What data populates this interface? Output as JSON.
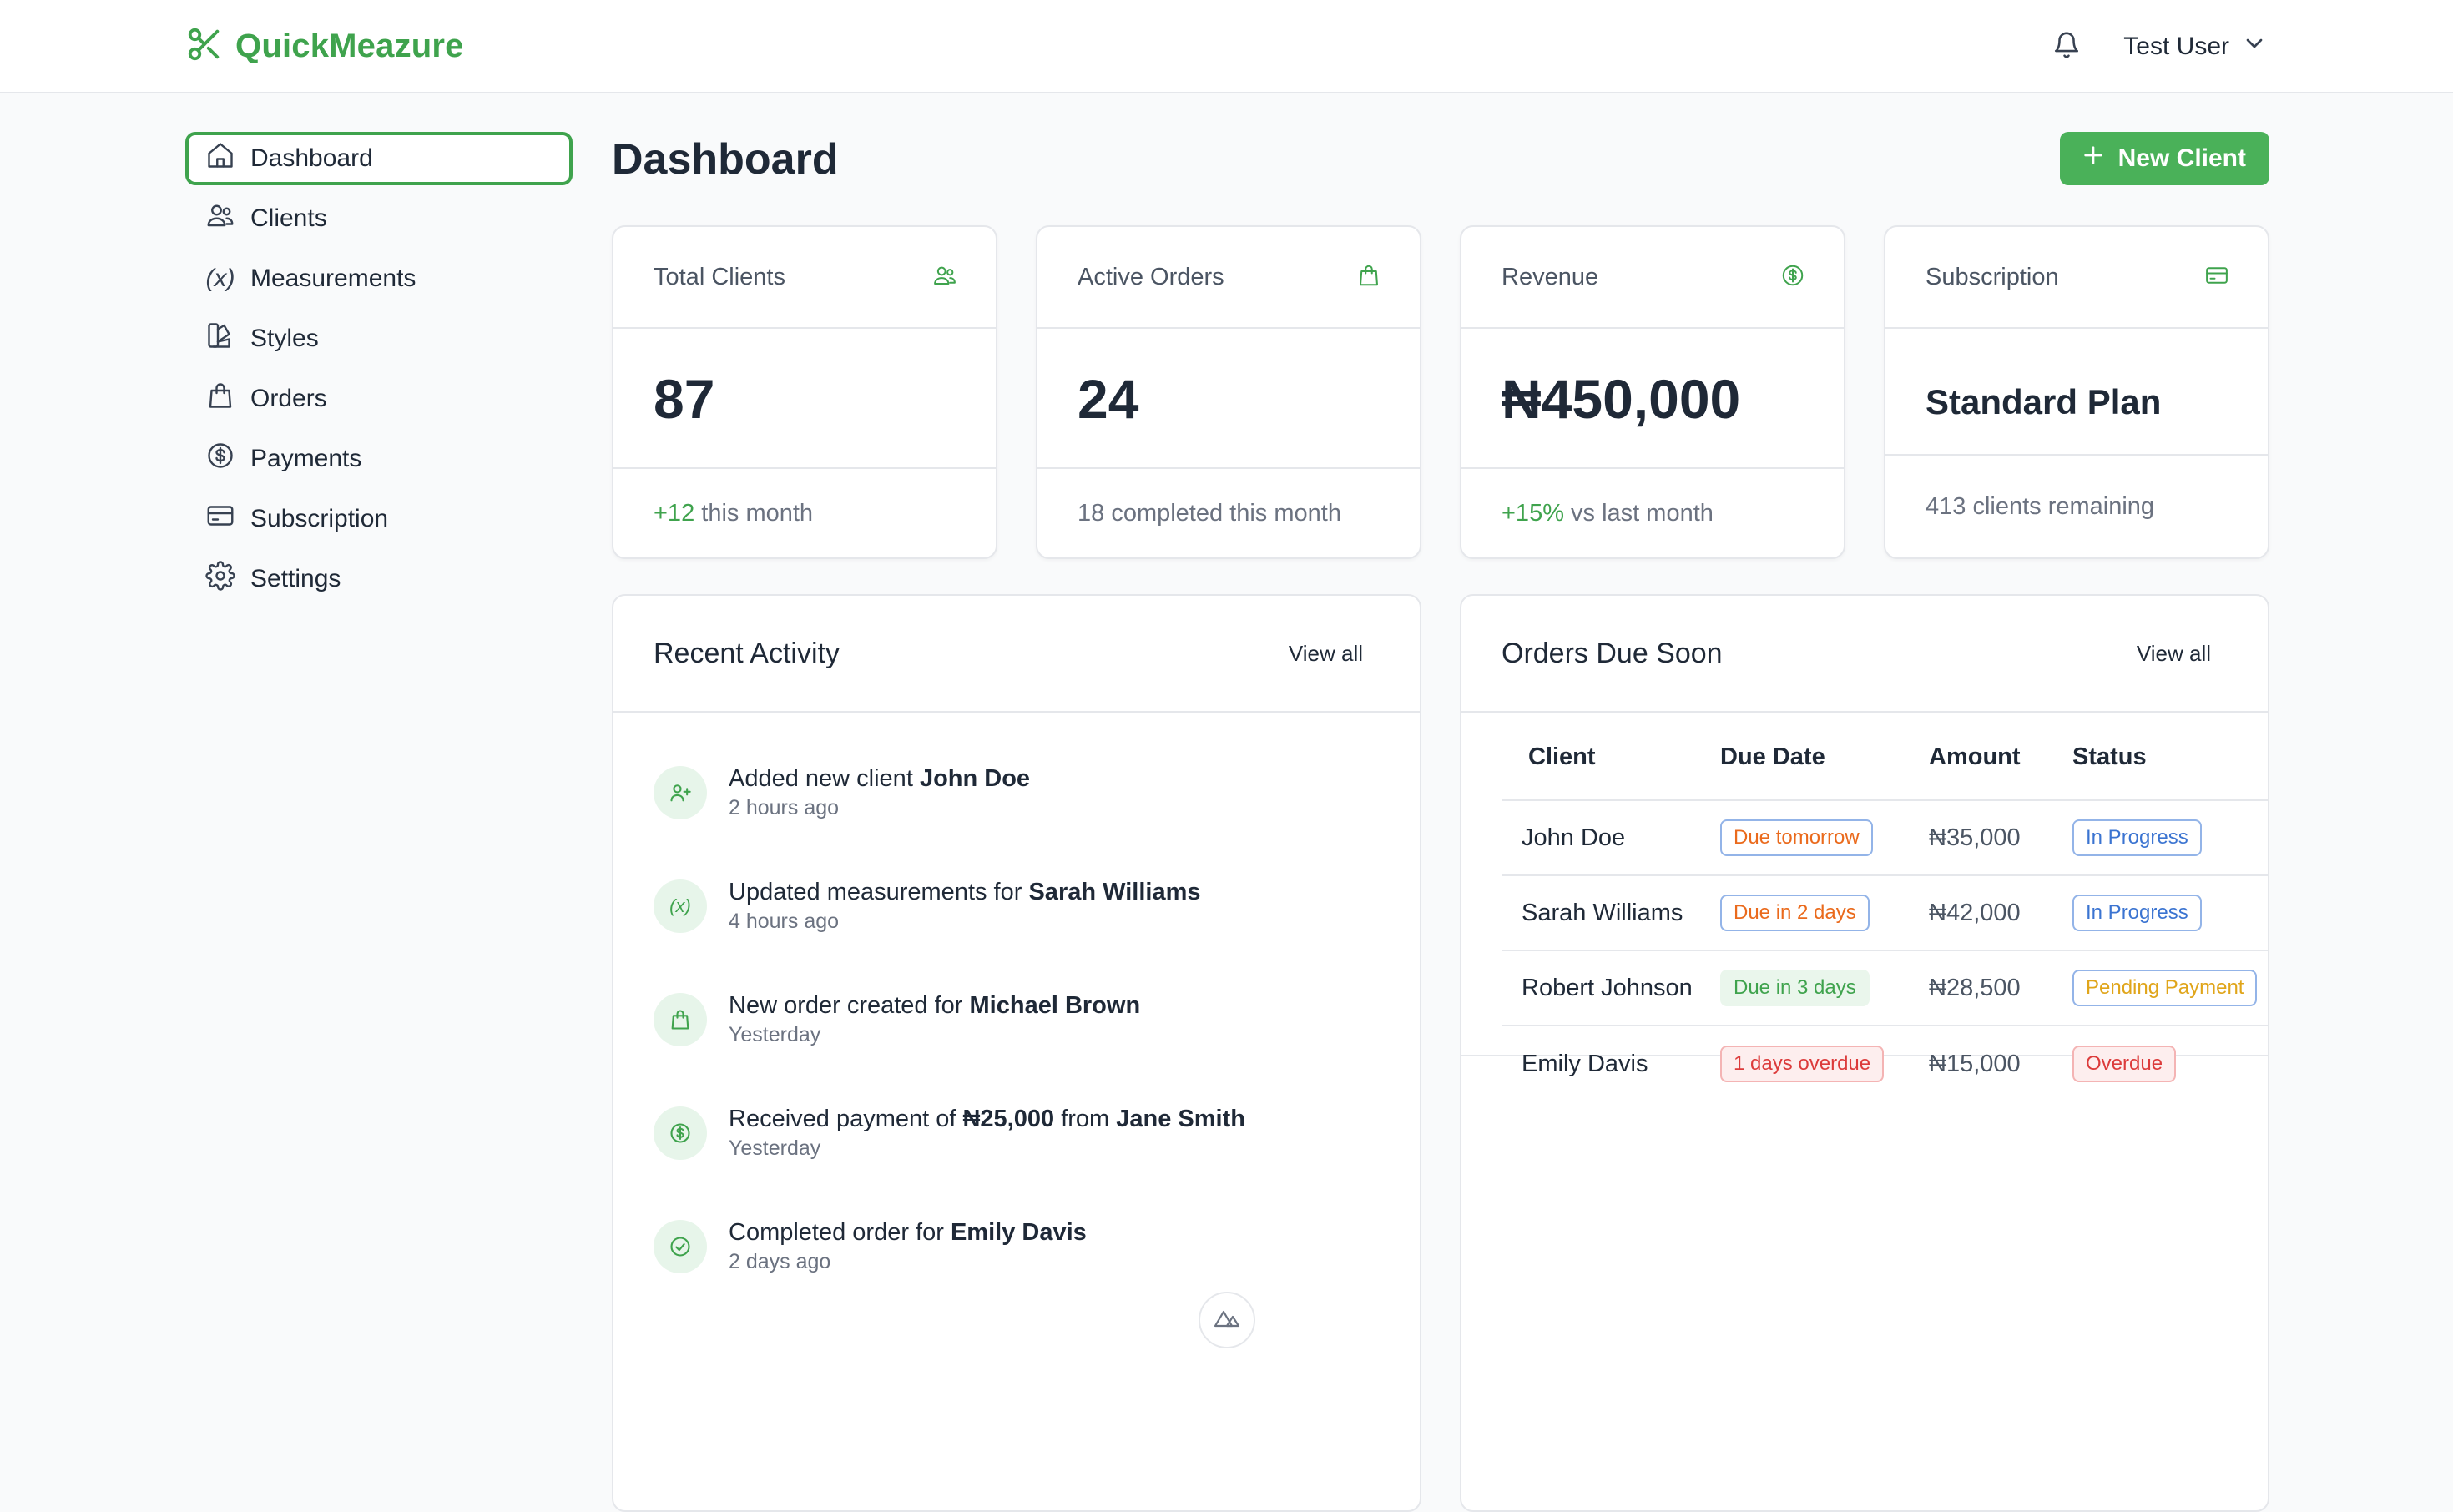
{
  "brand": {
    "name": "QuickMeazure",
    "color": "#3fa34d"
  },
  "header": {
    "user_name": "Test User"
  },
  "sidebar": {
    "items": [
      {
        "label": "Dashboard",
        "icon": "home-icon",
        "active": true
      },
      {
        "label": "Clients",
        "icon": "users-icon"
      },
      {
        "label": "Measurements",
        "icon": "variable-icon"
      },
      {
        "label": "Styles",
        "icon": "swatch-icon"
      },
      {
        "label": "Orders",
        "icon": "shopping-bag-icon"
      },
      {
        "label": "Payments",
        "icon": "dollar-circle-icon"
      },
      {
        "label": "Subscription",
        "icon": "credit-card-icon"
      },
      {
        "label": "Settings",
        "icon": "gear-icon"
      }
    ]
  },
  "main": {
    "title": "Dashboard",
    "new_client_label": "New Client"
  },
  "stats": [
    {
      "label": "Total Clients",
      "icon": "users-icon",
      "value": "87",
      "foot_highlight": "+12",
      "foot_rest": " this month"
    },
    {
      "label": "Active Orders",
      "icon": "shopping-bag-icon",
      "value": "24",
      "foot_highlight": "",
      "foot_rest": "18 completed this month"
    },
    {
      "label": "Revenue",
      "icon": "dollar-circle-icon",
      "value": "₦450,000",
      "foot_highlight": "+15%",
      "foot_rest": " vs last month"
    },
    {
      "label": "Subscription",
      "icon": "credit-card-icon",
      "value": "Standard Plan",
      "foot_highlight": "",
      "foot_rest": "413 clients remaining"
    }
  ],
  "recent_activity": {
    "title": "Recent Activity",
    "view_all": "View all",
    "items": [
      {
        "icon": "user-plus-icon",
        "prefix": "Added new client ",
        "bold1": "John Doe",
        "mid": "",
        "bold2": "",
        "time": "2 hours ago"
      },
      {
        "icon": "variable-icon",
        "prefix": "Updated measurements for ",
        "bold1": "Sarah Williams",
        "mid": "",
        "bold2": "",
        "time": "4 hours ago"
      },
      {
        "icon": "shopping-bag-icon",
        "prefix": "New order created for ",
        "bold1": "Michael Brown",
        "mid": "",
        "bold2": "",
        "time": "Yesterday"
      },
      {
        "icon": "dollar-circle-icon",
        "prefix": "Received payment of ",
        "bold1": "₦25,000",
        "mid": " from ",
        "bold2": "Jane Smith",
        "time": "Yesterday"
      },
      {
        "icon": "check-circle-icon",
        "prefix": "Completed order for ",
        "bold1": "Emily Davis",
        "mid": "",
        "bold2": "",
        "time": "2 days ago"
      }
    ]
  },
  "orders_due": {
    "title": "Orders Due Soon",
    "view_all": "View all",
    "columns": [
      "Client",
      "Due Date",
      "Amount",
      "Status"
    ],
    "rows": [
      {
        "client": "John Doe",
        "due": "Due tomorrow",
        "due_style": "orange",
        "amount": "₦35,000",
        "status": "In Progress",
        "status_style": "blue"
      },
      {
        "client": "Sarah Williams",
        "due": "Due in 2 days",
        "due_style": "orange",
        "amount": "₦42,000",
        "status": "In Progress",
        "status_style": "blue"
      },
      {
        "client": "Robert Johnson",
        "due": "Due in 3 days",
        "due_style": "green",
        "amount": "₦28,500",
        "status": "Pending Payment",
        "status_style": "yellow"
      },
      {
        "client": "Emily Davis",
        "due": "1 days overdue",
        "due_style": "red",
        "amount": "₦15,000",
        "status": "Overdue",
        "status_style": "red"
      }
    ]
  },
  "colors": {
    "accent": "#3fa34d",
    "button": "#4ab159",
    "border": "#e5e7eb"
  }
}
